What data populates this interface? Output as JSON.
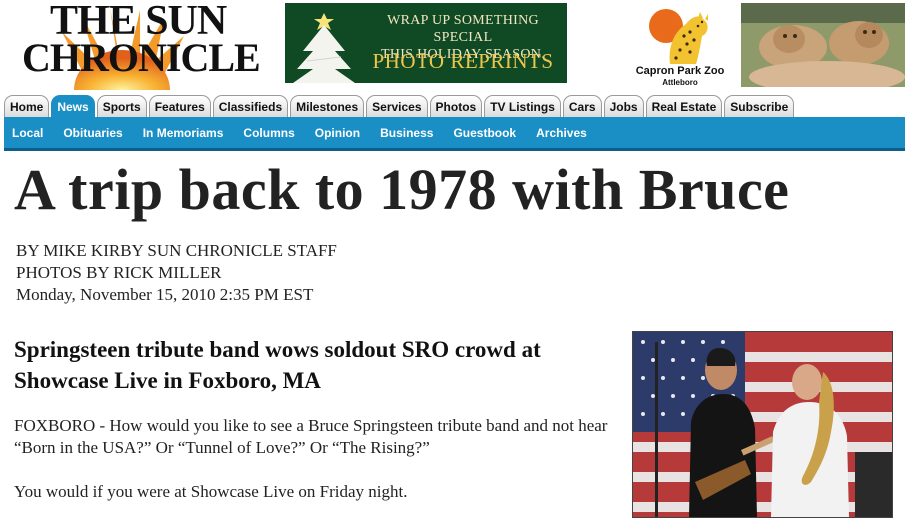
{
  "masthead": {
    "line1": "THE SUN",
    "line2": "CHRONICLE"
  },
  "ads": {
    "reprints": {
      "line1": "WRAP UP SOMETHING SPECIAL",
      "line2": "THIS HOLIDAY SEASON.",
      "cta": "PHOTO REPRINTS"
    },
    "zoo": {
      "name": "Capron Park Zoo",
      "location": "Attleboro"
    }
  },
  "nav": {
    "tabs": [
      "Home",
      "News",
      "Sports",
      "Features",
      "Classifieds",
      "Milestones",
      "Services",
      "Photos",
      "TV Listings",
      "Cars",
      "Jobs",
      "Real Estate",
      "Subscribe"
    ],
    "active": "News",
    "subnav": [
      "Local",
      "Obituaries",
      "In Memoriams",
      "Columns",
      "Opinion",
      "Business",
      "Guestbook",
      "Archives"
    ]
  },
  "article": {
    "headline": "A trip back to 1978 with Bruce",
    "byline": "BY MIKE KIRBY SUN CHRONICLE STAFF",
    "photo_credit": "PHOTOS BY RICK MILLER",
    "date": "Monday, November 15, 2010 2:35 PM EST",
    "subhead": "Springsteen tribute band wows soldout SRO crowd at Showcase Live in Foxboro, MA",
    "paragraphs": [
      "FOXBORO - How would you like to see a Bruce Springsteen tribute band and not hear “Born in the USA?” Or “Tunnel of Love?” Or “The Rising?”",
      "You would if you were at Showcase Live on Friday night."
    ]
  },
  "colors": {
    "nav_blue": "#1a8fc6",
    "ad_green": "#0f4a25",
    "ad_gold": "#f0c64a"
  }
}
